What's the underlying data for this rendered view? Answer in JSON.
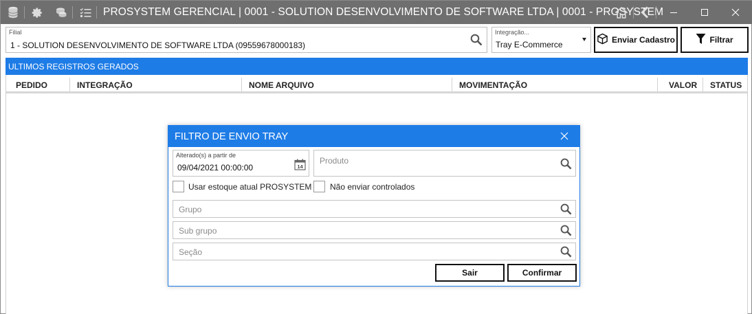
{
  "titlebar": {
    "title": "PROSYSTEM GERENCIAL | 0001 - SOLUTION DESENVOLVIMENTO DE SOFTWARE LTDA | 0001 - PROSYSTEM",
    "icons": [
      "database-icon",
      "gear-icon",
      "coins-icon",
      "checklist-icon",
      "home-icon",
      "back-icon",
      "minimize-icon",
      "maximize-icon",
      "close-icon"
    ]
  },
  "filters": {
    "filial_label": "Filial",
    "filial_value": "1 - SOLUTION DESENVOLVIMENTO DE SOFTWARE LTDA (09559678000183)",
    "integracao_label": "Integração...",
    "integracao_value": "Tray E-Commerce",
    "enviar_label": "Enviar Cadastro",
    "filtrar_label": "Filtrar"
  },
  "grid": {
    "header": "ULTIMOS REGISTROS GERADOS",
    "columns": [
      "PEDIDO",
      "INTEGRAÇÃO",
      "NOME ARQUIVO",
      "MOVIMENTAÇÃO",
      "VALOR",
      "STATUS"
    ],
    "rows": []
  },
  "dialog": {
    "title": "FILTRO DE ENVIO TRAY",
    "date_label": "Alterado(s) a partir de",
    "date_value": "09/04/2021 00:00:00",
    "calendar_day": "14",
    "produto_placeholder": "Produto",
    "chk_estoque_label": "Usar estoque atual PROSYSTEM",
    "chk_controlados_label": "Não enviar controlados",
    "grupo_placeholder": "Grupo",
    "subgrupo_placeholder": "Sub grupo",
    "secao_placeholder": "Seção",
    "sair_label": "Sair",
    "confirmar_label": "Confirmar"
  },
  "colors": {
    "titlebar": "#6f6f6f",
    "accent": "#1e7ce6",
    "button_border": "#111111"
  }
}
